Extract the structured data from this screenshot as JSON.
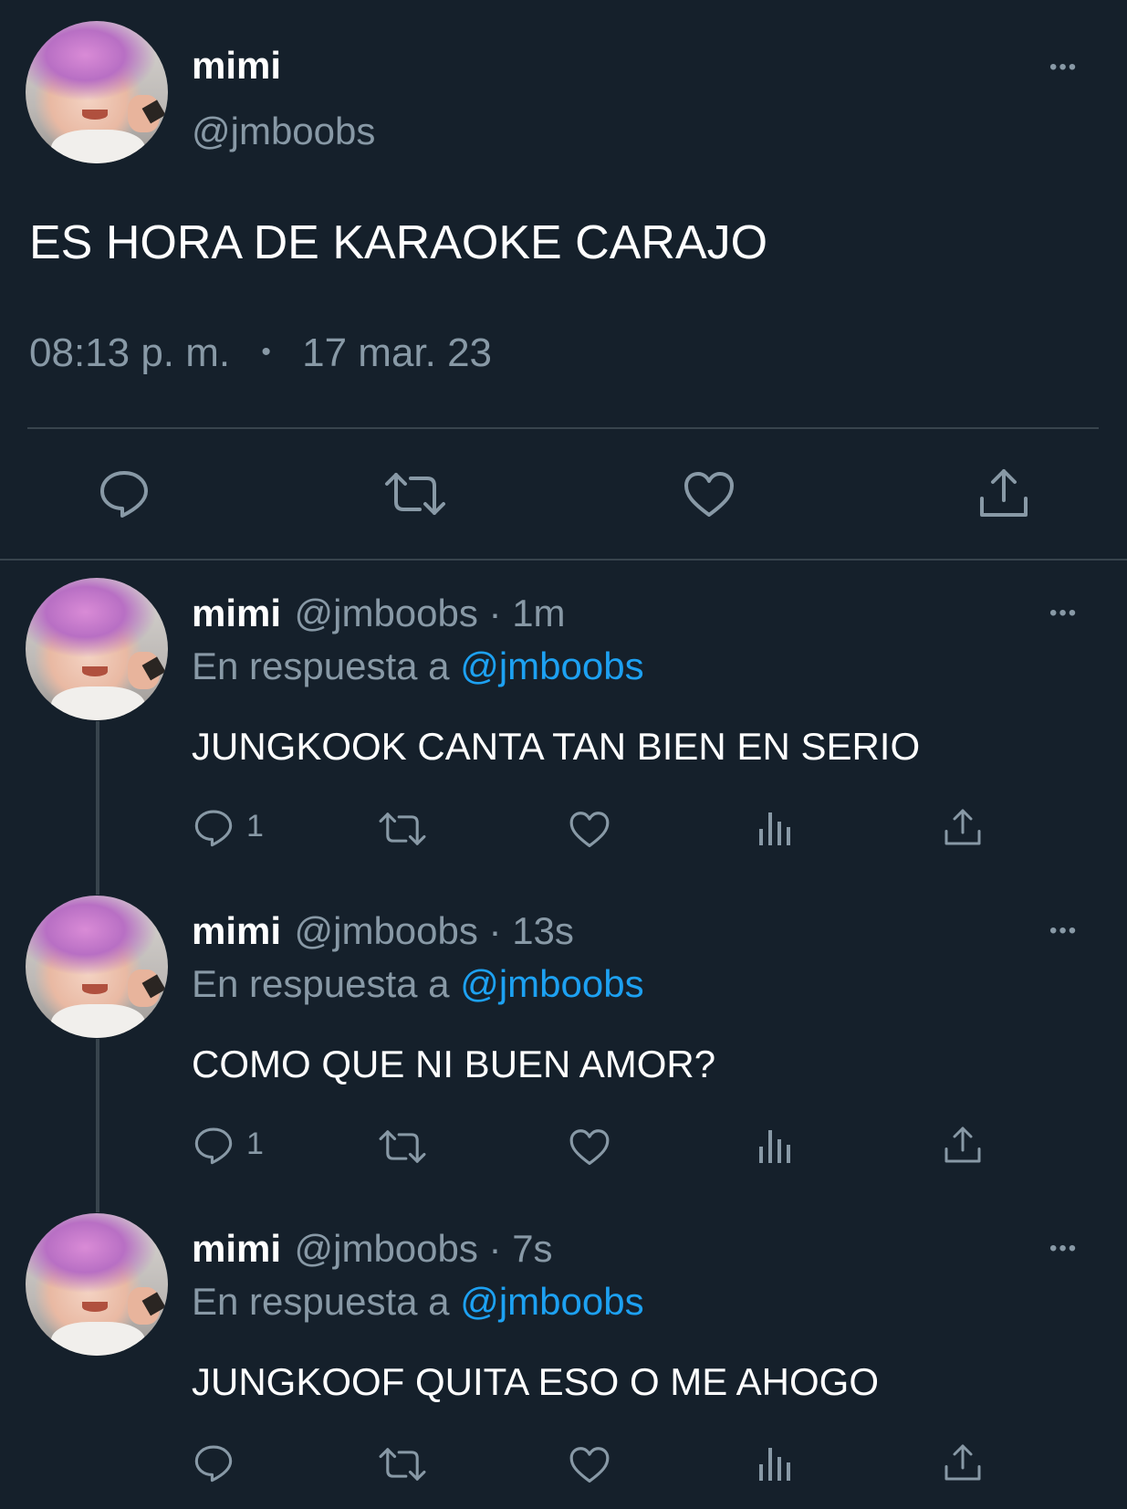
{
  "main_tweet": {
    "name": "mimi",
    "handle": "@jmboobs",
    "text": "ES HORA DE KARAOKE CARAJO",
    "time": "08:13 p. m.",
    "separator": "•",
    "date": "17 mar. 23",
    "more": "•••",
    "actions": [
      "reply-icon",
      "retweet-icon",
      "like-icon",
      "share-icon"
    ]
  },
  "replies": [
    {
      "name": "mimi",
      "meta": "@jmboobs · 1m",
      "reply_prefix": "En respuesta a ",
      "reply_to": "@jmboobs",
      "text": "JUNGKOOK CANTA TAN BIEN EN SERIO",
      "reply_count": "1",
      "more": "•••"
    },
    {
      "name": "mimi",
      "meta": "@jmboobs · 13s",
      "reply_prefix": "En respuesta a ",
      "reply_to": "@jmboobs",
      "text": "COMO QUE NI BUEN AMOR?",
      "reply_count": "1",
      "more": "•••"
    },
    {
      "name": "mimi",
      "meta": "@jmboobs · 7s",
      "reply_prefix": "En respuesta a ",
      "reply_to": "@jmboobs",
      "text": "JUNGKOOF QUITA ESO O ME AHOGO",
      "reply_count": "",
      "more": "•••"
    }
  ],
  "colors": {
    "background": "#15202b",
    "text": "#ffffff",
    "muted": "#8899a6",
    "link": "#1da1f2",
    "divider": "#38444d"
  }
}
